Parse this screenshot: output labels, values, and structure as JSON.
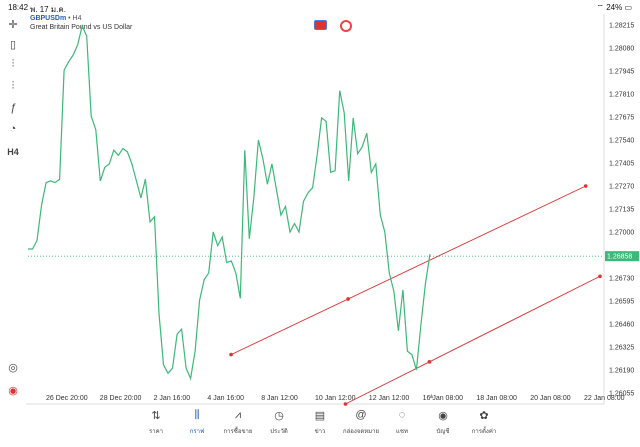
{
  "status": {
    "time": "18:42",
    "date": "พ. 17 ม.ค.",
    "battery": "24%"
  },
  "header": {
    "symbol": "GBPUSDm",
    "separator": "•",
    "timeframe": "H4",
    "description": "Great Britain Pound vs US Dollar"
  },
  "toolbar": {
    "timeframe": "H4"
  },
  "colors": {
    "line": "#3cb878",
    "trend": "#e03030",
    "accent": "#1f5fbf",
    "price_tag": "#3cb878"
  },
  "chart_data": {
    "type": "line",
    "current_price": "1.26858",
    "y_ticks": [
      "1.28215",
      "1.28080",
      "1.27945",
      "1.27810",
      "1.27675",
      "1.27540",
      "1.27405",
      "1.27270",
      "1.27135",
      "1.27000",
      "1.26865",
      "1.26730",
      "1.26595",
      "1.26460",
      "1.26325",
      "1.26190",
      "1.26055"
    ],
    "x_ticks": [
      "26 Dec 20:00",
      "28 Dec 20:00",
      "2 Jan 16:00",
      "4 Jan 16:00",
      "8 Jan 12:00",
      "10 Jan 12:00",
      "12 Jan 12:00",
      "16 Jan 08:00",
      "18 Jan 08:00",
      "20 Jan 08:00",
      "22 Jan 08:00"
    ],
    "ylim": [
      1.2599,
      1.2828
    ],
    "series": [
      {
        "values": [
          1.269,
          1.269,
          1.2695,
          1.2716,
          1.2729,
          1.273,
          1.2729,
          1.2731,
          1.2795,
          1.28,
          1.2804,
          1.281,
          1.2821,
          1.2815,
          1.2768,
          1.276,
          1.273,
          1.2738,
          1.274,
          1.2748,
          1.2745,
          1.2749,
          1.2747,
          1.274,
          1.273,
          1.272,
          1.2731,
          1.2706,
          1.2709,
          1.2652,
          1.2622,
          1.2617,
          1.262,
          1.264,
          1.2643,
          1.262,
          1.2614,
          1.263,
          1.266,
          1.2672,
          1.2676,
          1.27,
          1.2692,
          1.2697,
          1.2682,
          1.2683,
          1.2676,
          1.2661,
          1.2748,
          1.2696,
          1.272,
          1.2754,
          1.2743,
          1.2728,
          1.274,
          1.2725,
          1.271,
          1.2715,
          1.27,
          1.2705,
          1.27,
          1.2718,
          1.2723,
          1.2726,
          1.2745,
          1.2767,
          1.2765,
          1.2735,
          1.2736,
          1.2783,
          1.277,
          1.273,
          1.2767,
          1.2746,
          1.275,
          1.2758,
          1.2735,
          1.274,
          1.271,
          1.27,
          1.2676,
          1.2665,
          1.2642,
          1.2666,
          1.263,
          1.2628,
          1.2619,
          1.2646,
          1.267,
          1.2687
        ]
      }
    ],
    "trendlines": [
      {
        "start": [
          0.355,
          1.2628
        ],
        "end": [
          0.975,
          1.2727
        ]
      },
      {
        "start": [
          0.555,
          1.2599
        ],
        "end": [
          1.0,
          1.2674
        ]
      }
    ]
  },
  "tabs": [
    {
      "label": "ราคา",
      "icon": "arrows-updown-icon"
    },
    {
      "label": "กราฟ",
      "icon": "candles-icon"
    },
    {
      "label": "การซื้อขาย",
      "icon": "trade-chart-icon"
    },
    {
      "label": "ประวัติ",
      "icon": "history-icon"
    },
    {
      "label": "ข่าว",
      "icon": "news-icon"
    },
    {
      "label": "กล่องจดหมาย",
      "icon": "mail-at-icon"
    },
    {
      "label": "แชท",
      "icon": "chat-icon"
    },
    {
      "label": "บัญชี",
      "icon": "account-icon"
    },
    {
      "label": "การตั้งค่า",
      "icon": "settings-icon"
    }
  ]
}
